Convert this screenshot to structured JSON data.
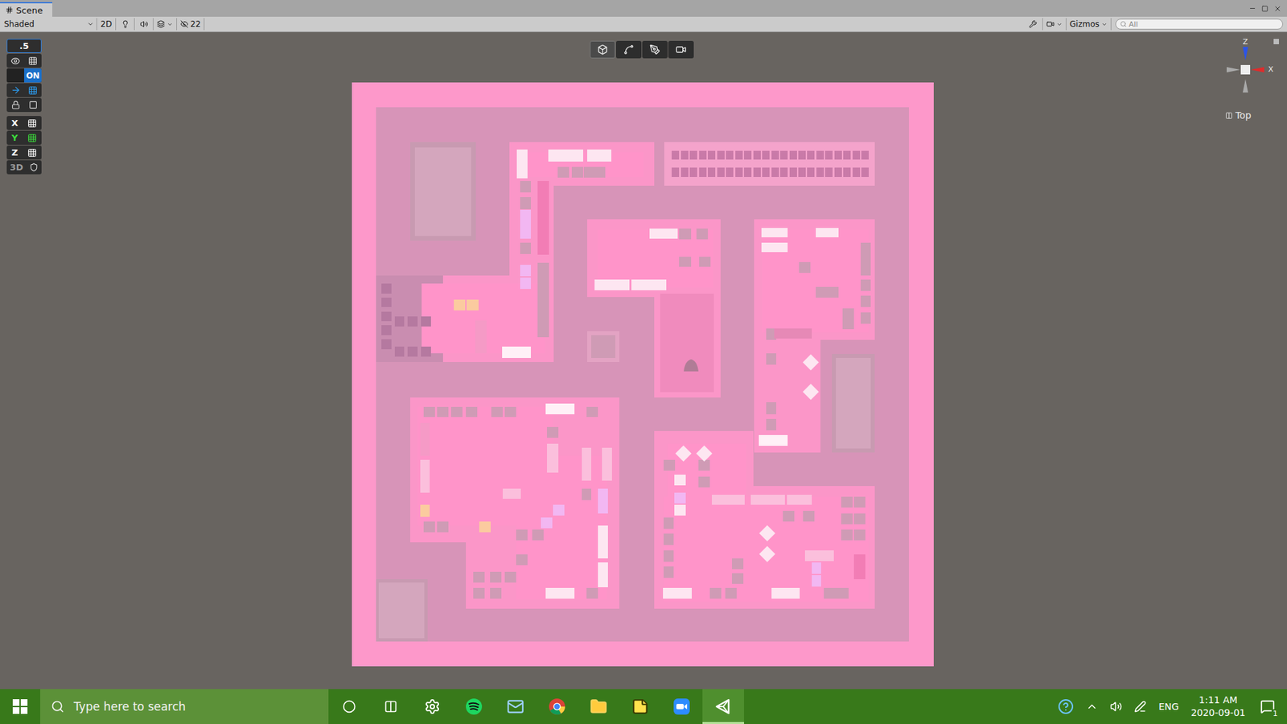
{
  "window": {
    "tab": "Scene"
  },
  "toolbar": {
    "shading": "Shaded",
    "mode2d": {
      "label": "2D",
      "on": false
    },
    "hidden_count": "22",
    "gizmos": "Gizmos",
    "search": {
      "placeholder": "All"
    }
  },
  "overlay": {
    "snap_value": ".5",
    "toggle": {
      "label": "ON",
      "on": true
    },
    "axes": [
      {
        "label": "X",
        "color": "#ffffff"
      },
      {
        "label": "Y",
        "color": "#3ddc3d"
      },
      {
        "label": "Z",
        "color": "#ffffff"
      }
    ],
    "mode": "3D"
  },
  "scene_tools": [
    {
      "selected": true
    },
    {
      "selected": false
    },
    {
      "selected": false
    },
    {
      "selected": false
    }
  ],
  "gizmo": {
    "up": "Z",
    "right": "X",
    "view": "Top"
  },
  "taskbar": {
    "search": {
      "placeholder": "Type here to search"
    },
    "apps": [
      {
        "selected": false
      },
      {
        "selected": false
      },
      {
        "selected": false
      },
      {
        "selected": false
      },
      {
        "selected": false
      },
      {
        "selected": false
      },
      {
        "selected": false
      },
      {
        "selected": true
      }
    ]
  },
  "tray": {
    "language": "ENG",
    "time": "1:11 AM",
    "date": "2020-09-01",
    "notifications": "1"
  }
}
